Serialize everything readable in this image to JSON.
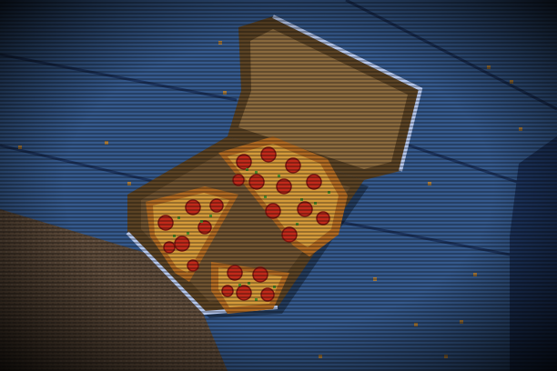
{
  "scene": {
    "palette": {
      "floor_blue": "#35598c",
      "floor_blue_dark": "#1d3560",
      "floor_blue_light": "#4f7ab4",
      "rug_brown": "#5e4b3a",
      "rug_brown_dark": "#3a2d24",
      "box_cardboard": "#8a6a3e",
      "box_cardboard_dark": "#5a4224",
      "box_inside": "#6e5230",
      "box_highlight": "#b6c8ee",
      "crust": "#b06a22",
      "cheese": "#d49a3a",
      "sauce": "#b83a1e",
      "pepperoni": "#c12a1a",
      "pepperoni_dark": "#7e1610",
      "herb": "#4e8a2a",
      "crumb": "#a87a3a"
    },
    "objects": {
      "box_lid": "pizza-box-lid",
      "box_base": "pizza-box-base",
      "slices": [
        "pizza-slice-upper",
        "pizza-slice-left",
        "pizza-slice-bottom"
      ]
    }
  }
}
